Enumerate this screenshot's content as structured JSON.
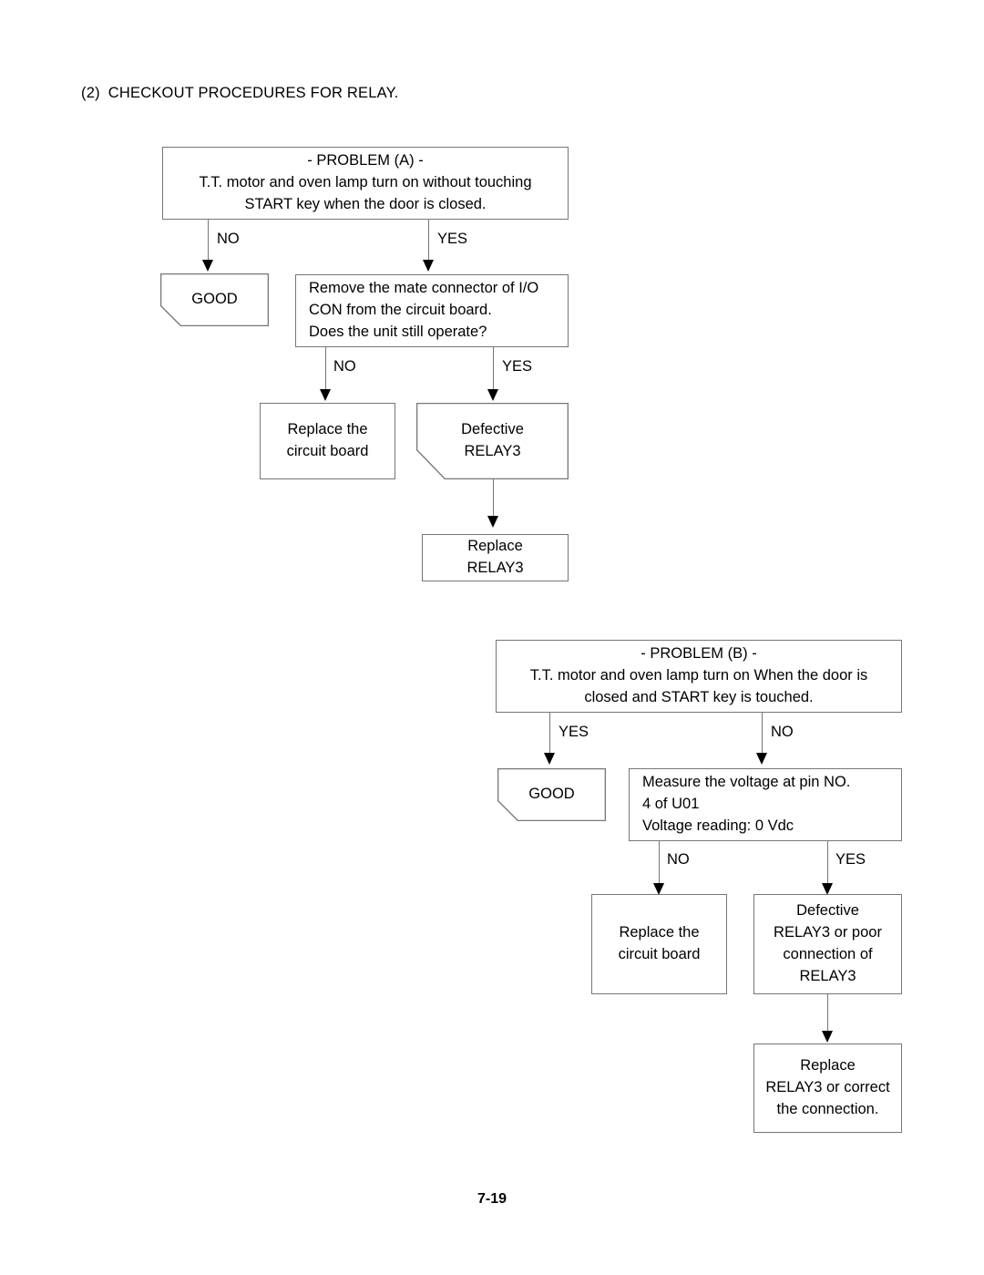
{
  "heading": {
    "number": "(2)",
    "text": "CHECKOUT PROCEDURES FOR RELAY."
  },
  "flow_a": {
    "problem": {
      "title": "- PROBLEM (A) -",
      "line1": "T.T. motor and oven lamp turn on without touching",
      "line2": "START key when the door is closed."
    },
    "branch_no": "NO",
    "branch_yes": "YES",
    "good": "GOOD",
    "remove": {
      "line1": "Remove the mate connector of I/O",
      "line2": "CON from the circuit board.",
      "line3": "Does the unit still operate?"
    },
    "branch2_no": "NO",
    "branch2_yes": "YES",
    "replace_board": {
      "line1": "Replace the",
      "line2": "circuit board"
    },
    "defective_relay": {
      "line1": "Defective",
      "line2": "RELAY3"
    },
    "replace_relay": {
      "line1": "Replace",
      "line2": "RELAY3"
    }
  },
  "flow_b": {
    "problem": {
      "title": "- PROBLEM (B) -",
      "line1": "T.T. motor and oven lamp turn on When the door is",
      "line2": "closed and START key is touched."
    },
    "branch_yes": "YES",
    "branch_no": "NO",
    "good": "GOOD",
    "measure": {
      "line1": "Measure the voltage at pin NO.",
      "line2": "4 of U01",
      "line3": "Voltage reading: 0 Vdc"
    },
    "branch2_no": "NO",
    "branch2_yes": "YES",
    "replace_board": {
      "line1": "Replace the",
      "line2": "circuit board"
    },
    "defective_relay": {
      "line1": "Defective",
      "line2": "RELAY3 or poor",
      "line3": "connection of",
      "line4": "RELAY3"
    },
    "replace_relay": {
      "line1": "Replace",
      "line2": "RELAY3 or correct",
      "line3": "the connection."
    }
  },
  "footer": {
    "page_number": "7-19"
  }
}
